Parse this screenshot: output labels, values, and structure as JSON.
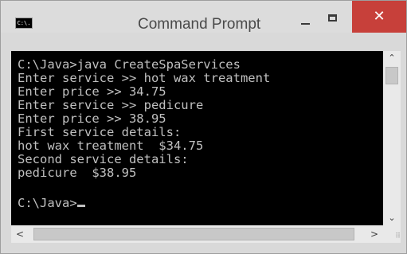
{
  "window": {
    "title": "Command Prompt",
    "app_icon_text": "C:\\.",
    "minimize_icon": "minimize-icon",
    "maximize_icon": "maximize-icon",
    "close_symbol": "✕",
    "close_color": "#c7403a"
  },
  "console": {
    "background": "#000000",
    "foreground": "#c0c0c0",
    "lines": [
      "C:\\Java>java CreateSpaServices",
      "Enter service >> hot wax treatment",
      "Enter price >> 34.75",
      "Enter service >> pedicure",
      "Enter price >> 38.95",
      "First service details:",
      "hot wax treatment  $34.75",
      "Second service details:",
      "pedicure  $38.95",
      "",
      "C:\\Java>"
    ]
  },
  "scrollbars": {
    "up_arrow": "⌃",
    "down_arrow": "⌄",
    "left_arrow": "<",
    "right_arrow": ">",
    "grip": "⠿"
  }
}
